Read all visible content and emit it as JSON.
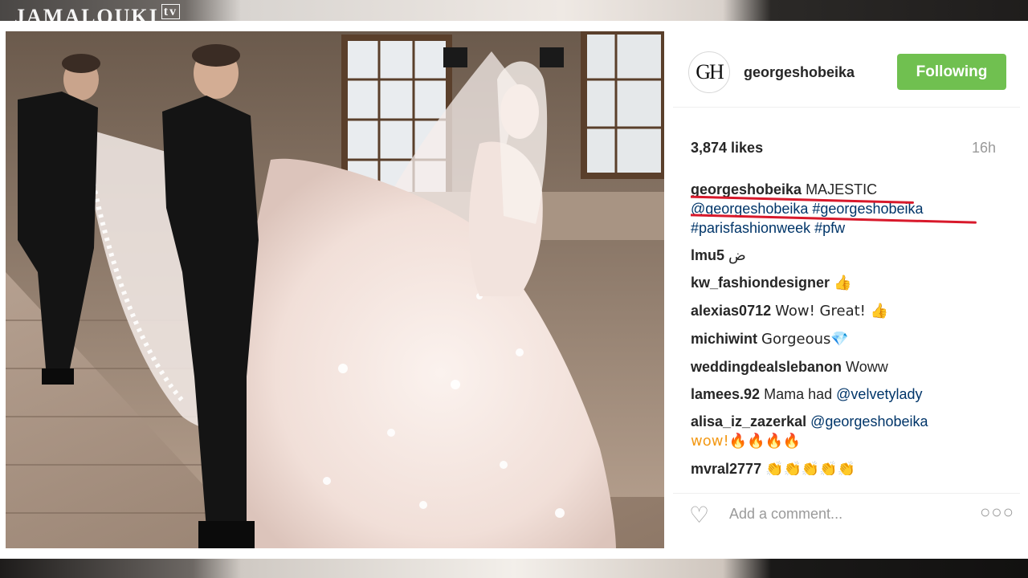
{
  "watermark": {
    "brand": "JAMALOUKI",
    "suffix": "tv"
  },
  "post": {
    "author": "georgeshobeika",
    "avatar_initials": "GH",
    "follow_label": "Following",
    "likes": "3,874 likes",
    "time": "16h",
    "caption": {
      "user": "georgeshobeika",
      "text": "MAJESTIC",
      "mention_1": "@georgeshobeika",
      "hashtag_1": "#georgeshobeika",
      "hashtag_2": "#parisfashionweek",
      "hashtag_3": "#pfw"
    },
    "comments": [
      {
        "user": "lmu5",
        "text": "ض"
      },
      {
        "user": "kw_fashiondesigner",
        "text": "👍"
      },
      {
        "user": "alexias0712",
        "text": "Wow! Great! 👍"
      },
      {
        "user": "michiwint",
        "text": "Gorgeous💎"
      },
      {
        "user": "weddingdealslebanon",
        "text": "Woww"
      },
      {
        "user": "lamees.92",
        "text": "Mama had",
        "mention": "@velvetylady"
      },
      {
        "user": "alisa_iz_zazerkal",
        "text": "wow!🔥🔥🔥🔥",
        "mention": "@georgeshobeika"
      },
      {
        "user": "mvral2777",
        "text": "👏👏👏👏👏"
      }
    ],
    "add_comment_placeholder": "Add a comment...",
    "more_icon": "more-options-icon",
    "heart_icon": "heart-icon"
  },
  "colors": {
    "follow_button": "#70c050",
    "hashtag": "#003569",
    "annotation_underline": "#d8192b"
  }
}
